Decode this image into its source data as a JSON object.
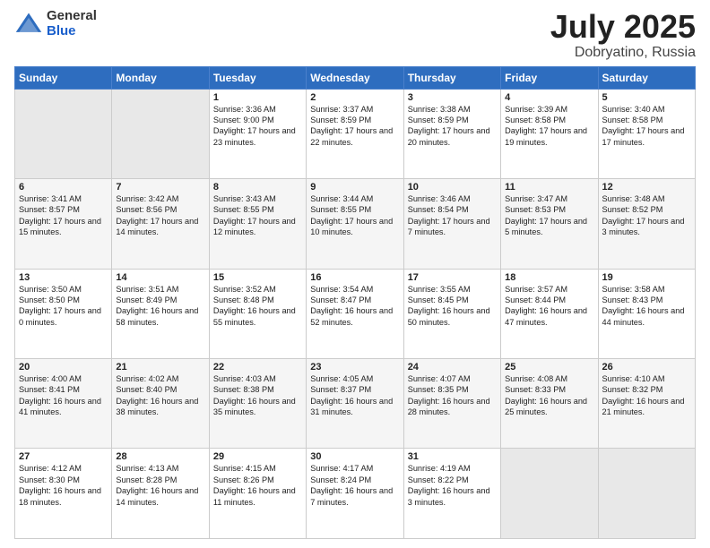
{
  "header": {
    "logo_general": "General",
    "logo_blue": "Blue",
    "title": "July 2025",
    "location": "Dobryatino, Russia"
  },
  "weekdays": [
    "Sunday",
    "Monday",
    "Tuesday",
    "Wednesday",
    "Thursday",
    "Friday",
    "Saturday"
  ],
  "weeks": [
    [
      {
        "day": "",
        "empty": true
      },
      {
        "day": "",
        "empty": true
      },
      {
        "day": "1",
        "sunrise": "Sunrise: 3:36 AM",
        "sunset": "Sunset: 9:00 PM",
        "daylight": "Daylight: 17 hours and 23 minutes."
      },
      {
        "day": "2",
        "sunrise": "Sunrise: 3:37 AM",
        "sunset": "Sunset: 8:59 PM",
        "daylight": "Daylight: 17 hours and 22 minutes."
      },
      {
        "day": "3",
        "sunrise": "Sunrise: 3:38 AM",
        "sunset": "Sunset: 8:59 PM",
        "daylight": "Daylight: 17 hours and 20 minutes."
      },
      {
        "day": "4",
        "sunrise": "Sunrise: 3:39 AM",
        "sunset": "Sunset: 8:58 PM",
        "daylight": "Daylight: 17 hours and 19 minutes."
      },
      {
        "day": "5",
        "sunrise": "Sunrise: 3:40 AM",
        "sunset": "Sunset: 8:58 PM",
        "daylight": "Daylight: 17 hours and 17 minutes."
      }
    ],
    [
      {
        "day": "6",
        "sunrise": "Sunrise: 3:41 AM",
        "sunset": "Sunset: 8:57 PM",
        "daylight": "Daylight: 17 hours and 15 minutes."
      },
      {
        "day": "7",
        "sunrise": "Sunrise: 3:42 AM",
        "sunset": "Sunset: 8:56 PM",
        "daylight": "Daylight: 17 hours and 14 minutes."
      },
      {
        "day": "8",
        "sunrise": "Sunrise: 3:43 AM",
        "sunset": "Sunset: 8:55 PM",
        "daylight": "Daylight: 17 hours and 12 minutes."
      },
      {
        "day": "9",
        "sunrise": "Sunrise: 3:44 AM",
        "sunset": "Sunset: 8:55 PM",
        "daylight": "Daylight: 17 hours and 10 minutes."
      },
      {
        "day": "10",
        "sunrise": "Sunrise: 3:46 AM",
        "sunset": "Sunset: 8:54 PM",
        "daylight": "Daylight: 17 hours and 7 minutes."
      },
      {
        "day": "11",
        "sunrise": "Sunrise: 3:47 AM",
        "sunset": "Sunset: 8:53 PM",
        "daylight": "Daylight: 17 hours and 5 minutes."
      },
      {
        "day": "12",
        "sunrise": "Sunrise: 3:48 AM",
        "sunset": "Sunset: 8:52 PM",
        "daylight": "Daylight: 17 hours and 3 minutes."
      }
    ],
    [
      {
        "day": "13",
        "sunrise": "Sunrise: 3:50 AM",
        "sunset": "Sunset: 8:50 PM",
        "daylight": "Daylight: 17 hours and 0 minutes."
      },
      {
        "day": "14",
        "sunrise": "Sunrise: 3:51 AM",
        "sunset": "Sunset: 8:49 PM",
        "daylight": "Daylight: 16 hours and 58 minutes."
      },
      {
        "day": "15",
        "sunrise": "Sunrise: 3:52 AM",
        "sunset": "Sunset: 8:48 PM",
        "daylight": "Daylight: 16 hours and 55 minutes."
      },
      {
        "day": "16",
        "sunrise": "Sunrise: 3:54 AM",
        "sunset": "Sunset: 8:47 PM",
        "daylight": "Daylight: 16 hours and 52 minutes."
      },
      {
        "day": "17",
        "sunrise": "Sunrise: 3:55 AM",
        "sunset": "Sunset: 8:45 PM",
        "daylight": "Daylight: 16 hours and 50 minutes."
      },
      {
        "day": "18",
        "sunrise": "Sunrise: 3:57 AM",
        "sunset": "Sunset: 8:44 PM",
        "daylight": "Daylight: 16 hours and 47 minutes."
      },
      {
        "day": "19",
        "sunrise": "Sunrise: 3:58 AM",
        "sunset": "Sunset: 8:43 PM",
        "daylight": "Daylight: 16 hours and 44 minutes."
      }
    ],
    [
      {
        "day": "20",
        "sunrise": "Sunrise: 4:00 AM",
        "sunset": "Sunset: 8:41 PM",
        "daylight": "Daylight: 16 hours and 41 minutes."
      },
      {
        "day": "21",
        "sunrise": "Sunrise: 4:02 AM",
        "sunset": "Sunset: 8:40 PM",
        "daylight": "Daylight: 16 hours and 38 minutes."
      },
      {
        "day": "22",
        "sunrise": "Sunrise: 4:03 AM",
        "sunset": "Sunset: 8:38 PM",
        "daylight": "Daylight: 16 hours and 35 minutes."
      },
      {
        "day": "23",
        "sunrise": "Sunrise: 4:05 AM",
        "sunset": "Sunset: 8:37 PM",
        "daylight": "Daylight: 16 hours and 31 minutes."
      },
      {
        "day": "24",
        "sunrise": "Sunrise: 4:07 AM",
        "sunset": "Sunset: 8:35 PM",
        "daylight": "Daylight: 16 hours and 28 minutes."
      },
      {
        "day": "25",
        "sunrise": "Sunrise: 4:08 AM",
        "sunset": "Sunset: 8:33 PM",
        "daylight": "Daylight: 16 hours and 25 minutes."
      },
      {
        "day": "26",
        "sunrise": "Sunrise: 4:10 AM",
        "sunset": "Sunset: 8:32 PM",
        "daylight": "Daylight: 16 hours and 21 minutes."
      }
    ],
    [
      {
        "day": "27",
        "sunrise": "Sunrise: 4:12 AM",
        "sunset": "Sunset: 8:30 PM",
        "daylight": "Daylight: 16 hours and 18 minutes."
      },
      {
        "day": "28",
        "sunrise": "Sunrise: 4:13 AM",
        "sunset": "Sunset: 8:28 PM",
        "daylight": "Daylight: 16 hours and 14 minutes."
      },
      {
        "day": "29",
        "sunrise": "Sunrise: 4:15 AM",
        "sunset": "Sunset: 8:26 PM",
        "daylight": "Daylight: 16 hours and 11 minutes."
      },
      {
        "day": "30",
        "sunrise": "Sunrise: 4:17 AM",
        "sunset": "Sunset: 8:24 PM",
        "daylight": "Daylight: 16 hours and 7 minutes."
      },
      {
        "day": "31",
        "sunrise": "Sunrise: 4:19 AM",
        "sunset": "Sunset: 8:22 PM",
        "daylight": "Daylight: 16 hours and 3 minutes."
      },
      {
        "day": "",
        "empty": true
      },
      {
        "day": "",
        "empty": true
      }
    ]
  ]
}
